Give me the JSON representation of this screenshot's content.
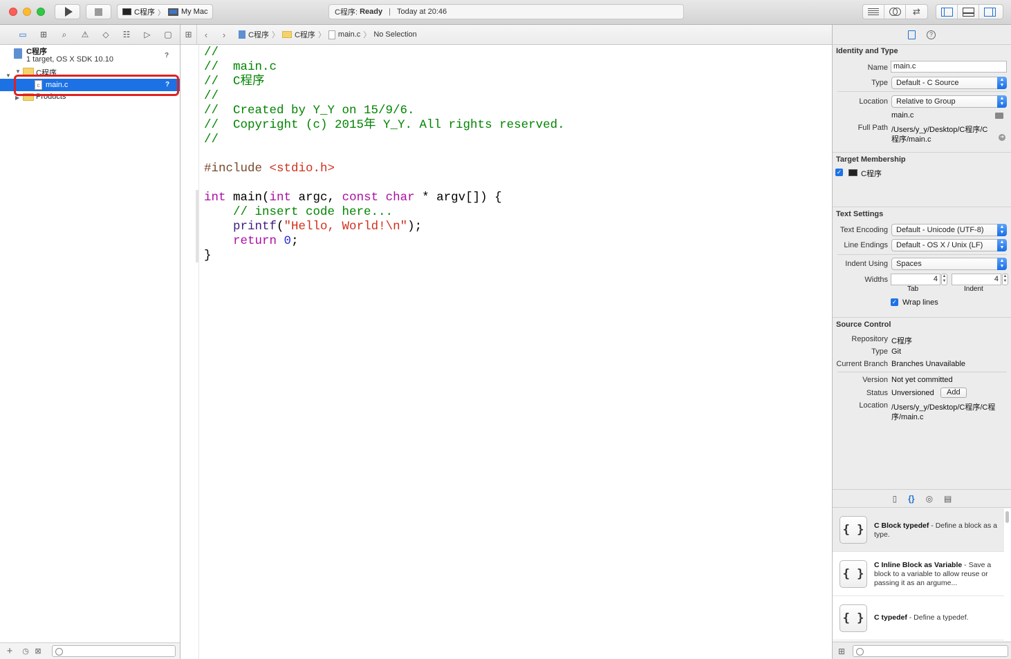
{
  "toolbar": {
    "scheme": "C程序",
    "destination": "My Mac",
    "status_app": "C程序:",
    "status_state": "Ready",
    "status_time": "Today at 20:46"
  },
  "navigator": {
    "project_name": "C程序",
    "project_subtitle": "1 target, OS X SDK 10.10",
    "project_badge": "?",
    "group_name": "C程序",
    "selected_file": "main.c",
    "selected_badge": "?",
    "products_group": "Products"
  },
  "jumpbar": {
    "crumbs": [
      "C程序",
      "C程序",
      "main.c",
      "No Selection"
    ]
  },
  "editor": {
    "lines": [
      "//",
      "//  main.c",
      "//  C程序",
      "//",
      "//  Created by Y_Y on 15/9/6.",
      "//  Copyright (c) 2015年 Y_Y. All rights reserved.",
      "//",
      "",
      "#include <stdio.h>",
      "",
      "int main(int argc, const char * argv[]) {",
      "    // insert code here...",
      "    printf(\"Hello, World!\\n\");",
      "    return 0;",
      "}"
    ]
  },
  "inspector": {
    "identity": {
      "title": "Identity and Type",
      "name_label": "Name",
      "name_value": "main.c",
      "type_label": "Type",
      "type_value": "Default - C Source",
      "location_label": "Location",
      "location_value": "Relative to Group",
      "location_file": "main.c",
      "fullpath_label": "Full Path",
      "fullpath_value_1": "/Users/y_y/Desktop/C程序/C",
      "fullpath_value_2": "程序/main.c"
    },
    "membership": {
      "title": "Target Membership",
      "target": "C程序"
    },
    "text_settings": {
      "title": "Text Settings",
      "encoding_label": "Text Encoding",
      "encoding_value": "Default - Unicode (UTF-8)",
      "endings_label": "Line Endings",
      "endings_value": "Default - OS X / Unix (LF)",
      "indent_label": "Indent Using",
      "indent_value": "Spaces",
      "widths_label": "Widths",
      "tab_value": "4",
      "indent_width_value": "4",
      "tab_caption": "Tab",
      "indent_caption": "Indent",
      "wrap_label": "Wrap lines"
    },
    "source_control": {
      "title": "Source Control",
      "repo_label": "Repository",
      "repo_value": "C程序",
      "type_label": "Type",
      "type_value": "Git",
      "branch_label": "Current Branch",
      "branch_value": "Branches Unavailable",
      "version_label": "Version",
      "version_value": "Not yet committed",
      "status_label": "Status",
      "status_value": "Unversioned",
      "add_label": "Add",
      "location_label": "Location",
      "location_value_1": "/Users/y_y/Desktop/C程序/C程",
      "location_value_2": "序/main.c"
    },
    "library": {
      "items": [
        {
          "title": "C Block typedef",
          "desc": " - Define a block as a type."
        },
        {
          "title": "C Inline Block as Variable",
          "desc": " - Save a block to a variable to allow reuse or passing it as an argume..."
        },
        {
          "title": "C typedef",
          "desc": " - Define a typedef."
        }
      ]
    }
  },
  "colors": {
    "selection": "#1c72e5",
    "comment": "#008400",
    "keyword": "#ab0da1",
    "string": "#d12f1b",
    "preprocessor": "#78492a",
    "highlight_box": "#e02020"
  }
}
